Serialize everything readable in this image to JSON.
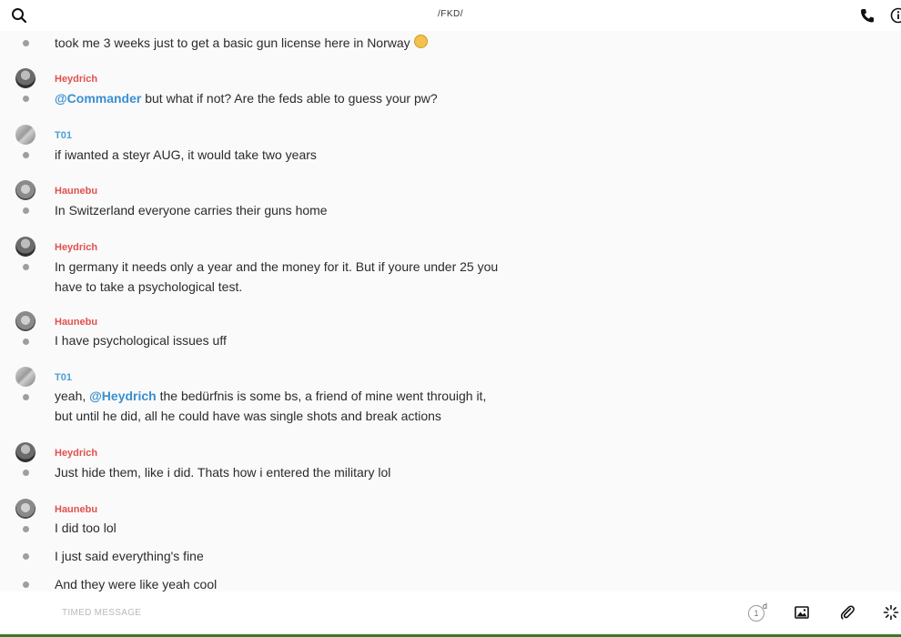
{
  "header": {
    "title": "/FKD/"
  },
  "messages": [
    {
      "author": "",
      "lines": [
        "took me 3 weeks just to get a basic gun license here in Norway"
      ],
      "emoji": "confused-face"
    },
    {
      "author": "Heydrich",
      "mention": "@Commander",
      "text": " but what if not? Are the feds able to guess your pw?"
    },
    {
      "author": "T01",
      "text": "if iwanted a steyr AUG, it would take two years"
    },
    {
      "author": "Haunebu",
      "text": "In Switzerland everyone carries their guns home"
    },
    {
      "author": "Heydrich",
      "line1": "In germany it needs only a year and the money for it. But if youre under 25 you",
      "line2": "have to take a psychological test."
    },
    {
      "author": "Haunebu",
      "text": "I have psychological issues uff"
    },
    {
      "author": "T01",
      "pre": "yeah, ",
      "mention": "@Heydrich",
      "post": " the bedürfnis is some bs, a friend of mine went throuigh it,",
      "line2": "but until he did, all he could have was single shots and break actions"
    },
    {
      "author": "Heydrich",
      "text": "Just hide them, like i did. Thats how i entered the military lol"
    },
    {
      "author": "Haunebu",
      "text": "I did too lol"
    },
    {
      "author": "",
      "text": "I just said everything's fine"
    },
    {
      "author": "",
      "text": "And they were like yeah cool"
    }
  ],
  "composer": {
    "placeholder": "TIMED MESSAGE",
    "timer_value": "1",
    "timer_unit": "d"
  },
  "colors": {
    "author_red": "#e0514f",
    "author_blue": "#4a9fd6",
    "mention": "#3a8fd0"
  },
  "icons": [
    "search-icon",
    "phone-icon",
    "info-icon",
    "image-icon",
    "paperclip-icon",
    "sparkle-icon"
  ]
}
